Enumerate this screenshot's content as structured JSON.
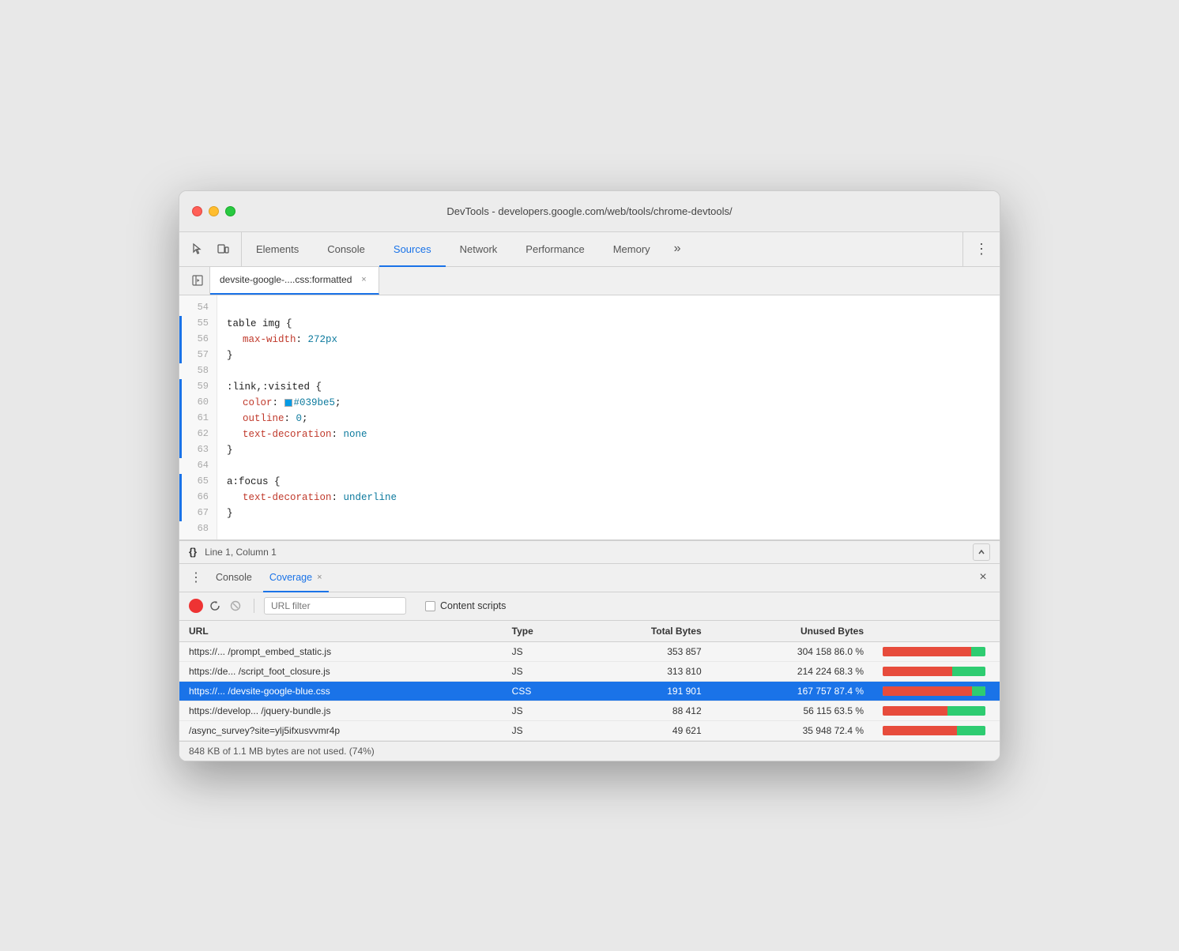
{
  "window": {
    "title": "DevTools - developers.google.com/web/tools/chrome-devtools/"
  },
  "toolbar": {
    "tabs": [
      {
        "id": "elements",
        "label": "Elements",
        "active": false
      },
      {
        "id": "console",
        "label": "Console",
        "active": false
      },
      {
        "id": "sources",
        "label": "Sources",
        "active": true
      },
      {
        "id": "network",
        "label": "Network",
        "active": false
      },
      {
        "id": "performance",
        "label": "Performance",
        "active": false
      },
      {
        "id": "memory",
        "label": "Memory",
        "active": false
      }
    ],
    "more_label": "»",
    "kebab_label": "⋮"
  },
  "file_tab": {
    "name": "devsite-google-....css:formatted",
    "close": "×"
  },
  "code": {
    "lines": [
      {
        "num": "54",
        "content": "",
        "has_indicator": false
      },
      {
        "num": "55",
        "content": "table img {",
        "has_indicator": true
      },
      {
        "num": "56",
        "content": "    max-width: 272px",
        "has_indicator": true
      },
      {
        "num": "57",
        "content": "}",
        "has_indicator": true
      },
      {
        "num": "58",
        "content": "",
        "has_indicator": false
      },
      {
        "num": "59",
        "content": ":link,:visited {",
        "has_indicator": true
      },
      {
        "num": "60",
        "content": "    color: #039be5;",
        "has_indicator": true
      },
      {
        "num": "61",
        "content": "    outline: 0;",
        "has_indicator": true
      },
      {
        "num": "62",
        "content": "    text-decoration: none",
        "has_indicator": true
      },
      {
        "num": "63",
        "content": "}",
        "has_indicator": true
      },
      {
        "num": "64",
        "content": "",
        "has_indicator": false
      },
      {
        "num": "65",
        "content": "a:focus {",
        "has_indicator": true
      },
      {
        "num": "66",
        "content": "    text-decoration: underline",
        "has_indicator": true
      },
      {
        "num": "67",
        "content": "}",
        "has_indicator": true
      },
      {
        "num": "68",
        "content": "",
        "has_indicator": false
      }
    ]
  },
  "status_bar": {
    "braces": "{}",
    "position": "Line 1, Column 1"
  },
  "bottom_panel": {
    "tabs": [
      {
        "id": "console",
        "label": "Console",
        "active": false,
        "closeable": false
      },
      {
        "id": "coverage",
        "label": "Coverage",
        "active": true,
        "closeable": true
      }
    ],
    "close_label": "×"
  },
  "coverage": {
    "filter_placeholder": "URL filter",
    "content_scripts_label": "Content scripts",
    "table_headers": {
      "url": "URL",
      "type": "Type",
      "total_bytes": "Total Bytes",
      "unused_bytes": "Unused Bytes",
      "bar": ""
    },
    "rows": [
      {
        "url": "https://... /prompt_embed_static.js",
        "type": "JS",
        "total_bytes": "353 857",
        "unused_bytes": "304 158",
        "unused_pct": "86.0 %",
        "bar_unused_pct": 86,
        "bar_used_pct": 14,
        "selected": false,
        "bar_color_unused": "#e74c3c",
        "bar_color_used": "#2ecc71"
      },
      {
        "url": "https://de... /script_foot_closure.js",
        "type": "JS",
        "total_bytes": "313 810",
        "unused_bytes": "214 224",
        "unused_pct": "68.3 %",
        "bar_unused_pct": 68,
        "bar_used_pct": 32,
        "selected": false,
        "bar_color_unused": "#e74c3c",
        "bar_color_used": "#2ecc71"
      },
      {
        "url": "https://... /devsite-google-blue.css",
        "type": "CSS",
        "total_bytes": "191 901",
        "unused_bytes": "167 757",
        "unused_pct": "87.4 %",
        "bar_unused_pct": 87,
        "bar_used_pct": 13,
        "selected": true,
        "bar_color_unused": "#e74c3c",
        "bar_color_used": "#2ecc71"
      },
      {
        "url": "https://develop... /jquery-bundle.js",
        "type": "JS",
        "total_bytes": "88 412",
        "unused_bytes": "56 115",
        "unused_pct": "63.5 %",
        "bar_unused_pct": 63,
        "bar_used_pct": 37,
        "selected": false,
        "bar_color_unused": "#e74c3c",
        "bar_color_used": "#2ecc71"
      },
      {
        "url": "/async_survey?site=ylj5ifxusvvmr4p",
        "type": "JS",
        "total_bytes": "49 621",
        "unused_bytes": "35 948",
        "unused_pct": "72.4 %",
        "bar_unused_pct": 72,
        "bar_used_pct": 28,
        "selected": false,
        "bar_color_unused": "#e74c3c",
        "bar_color_used": "#2ecc71"
      }
    ],
    "footer": "848 KB of 1.1 MB bytes are not used. (74%)"
  },
  "colors": {
    "accent_blue": "#1a73e8",
    "link_color": "#039be5",
    "property_red": "#c0392b",
    "value_blue": "#0d7a9e",
    "indicator_blue": "#1a73e8"
  }
}
